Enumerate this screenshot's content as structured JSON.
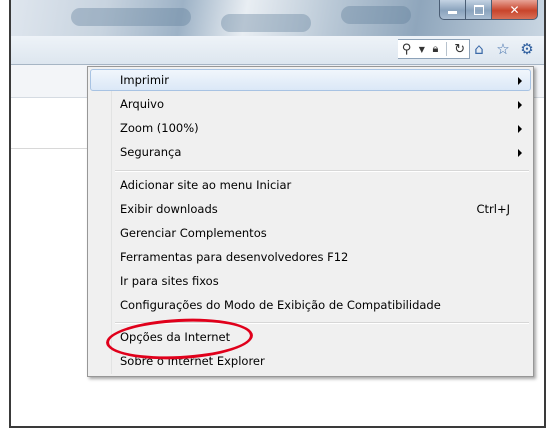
{
  "window": {
    "buttons": {
      "minimize_icon": "minimize-icon",
      "maximize_icon": "maximize-icon",
      "close_icon": "close-icon"
    }
  },
  "toolbar": {
    "icons": [
      "search-icon",
      "dropdown-arrow-icon",
      "lock-icon",
      "refresh-icon",
      "home-icon",
      "favorites-star-icon",
      "tools-gear-icon"
    ]
  },
  "menu": {
    "groups": [
      [
        {
          "label": "Imprimir",
          "submenu": true
        },
        {
          "label": "Arquivo",
          "submenu": true
        },
        {
          "label": "Zoom (100%)",
          "submenu": true
        },
        {
          "label": "Segurança",
          "submenu": true
        }
      ],
      [
        {
          "label": "Adicionar site ao menu Iniciar"
        },
        {
          "label": "Exibir downloads",
          "shortcut": "Ctrl+J"
        },
        {
          "label": "Gerenciar Complementos"
        },
        {
          "label": "Ferramentas para desenvolvedores F12"
        },
        {
          "label": "Ir para sites fixos"
        },
        {
          "label": "Configurações do Modo de Exibição de Compatibilidade"
        }
      ],
      [
        {
          "label": "Opções da Internet"
        },
        {
          "label": "Sobre o Internet Explorer"
        }
      ]
    ],
    "highlighted_item": "Imprimir",
    "annotated_item": "Opções da Internet",
    "annotation_color": "#e0001b",
    "hover_color": "#dbe8f7"
  }
}
